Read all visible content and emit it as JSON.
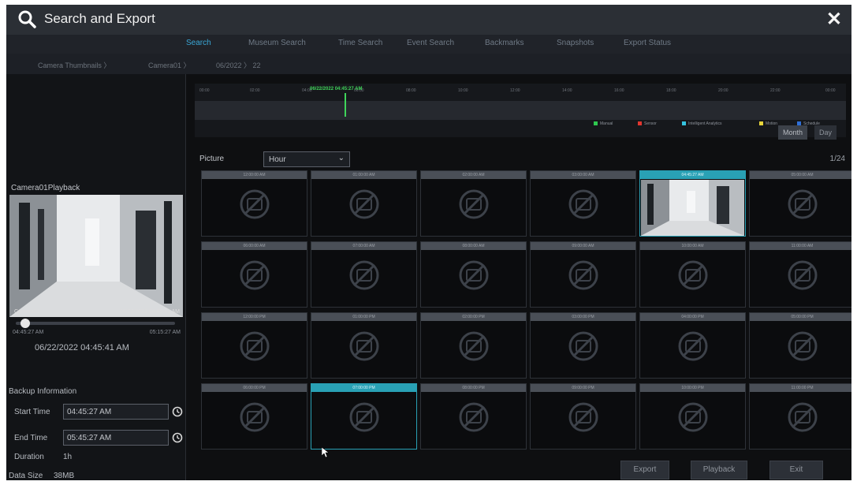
{
  "window": {
    "title": "Search and Export",
    "search_icon": "search-icon",
    "close_label": "✕"
  },
  "tabs": [
    {
      "label": "Search",
      "active": true
    },
    {
      "label": "Museum Search",
      "active": false
    },
    {
      "label": "Time Search",
      "active": false
    },
    {
      "label": "Event Search",
      "active": false
    },
    {
      "label": "Backmarks",
      "active": false
    },
    {
      "label": "Snapshots",
      "active": false
    },
    {
      "label": "Export Status",
      "active": false
    }
  ],
  "breadcrumb": [
    "Camera Thumbnails 〉",
    "Camera01 〉",
    "06/2022 〉 22"
  ],
  "playback": {
    "title": "Camera01Playback",
    "cam_label": "Camera01",
    "cam_label_right": "06/22/2022 04:45:41 AM",
    "progress": 0.05,
    "start_time": "04:45:27 AM",
    "end_time": "05:15:27 AM",
    "current": "06/22/2022 04:45:41 AM"
  },
  "backup": {
    "title": "Backup Information",
    "start_label": "Start Time",
    "start_value": "04:45:27 AM",
    "end_label": "End Time",
    "end_value": "05:45:27 AM",
    "duration_label": "Duration",
    "duration_value": "1h",
    "size_label": "Data Size",
    "size_value": "38MB"
  },
  "timeline": {
    "cursor_label": "06/22/2022 04:45:27 AM",
    "ticks": [
      "00:00",
      "02:00",
      "04:00",
      "06:00",
      "08:00",
      "10:00",
      "12:00",
      "14:00",
      "16:00",
      "18:00",
      "20:00",
      "22:00",
      "00:00"
    ],
    "legend": [
      {
        "label": "Manual",
        "color": "#2fc84f"
      },
      {
        "label": "Sensor",
        "color": "#e2362f"
      },
      {
        "label": "Intelligent Analytics",
        "color": "#35c4e0"
      },
      {
        "label": "Motion",
        "color": "#e8d53a"
      },
      {
        "label": "Schedule",
        "color": "#2f6fd8"
      }
    ],
    "month_label": "Month",
    "day_label": "Day"
  },
  "picture": {
    "label": "Picture",
    "select_value": "Hour",
    "page": "1/24"
  },
  "grid": [
    {
      "time": "12:00:00 AM"
    },
    {
      "time": "01:00:00 AM"
    },
    {
      "time": "02:00:00 AM"
    },
    {
      "time": "03:00:00 AM"
    },
    {
      "time": "04:45:27 AM",
      "selected": true,
      "photo": true
    },
    {
      "time": "05:00:00 AM"
    },
    {
      "time": "06:00:00 AM"
    },
    {
      "time": "07:00:00 AM"
    },
    {
      "time": "08:00:00 AM"
    },
    {
      "time": "09:00:00 AM"
    },
    {
      "time": "10:00:00 AM"
    },
    {
      "time": "11:00:00 AM"
    },
    {
      "time": "12:00:00 PM"
    },
    {
      "time": "01:00:00 PM"
    },
    {
      "time": "02:00:00 PM"
    },
    {
      "time": "03:00:00 PM"
    },
    {
      "time": "04:00:00 PM"
    },
    {
      "time": "05:00:00 PM"
    },
    {
      "time": "06:00:00 PM"
    },
    {
      "time": "07:00:00 PM",
      "selected": true
    },
    {
      "time": "08:00:00 PM"
    },
    {
      "time": "09:00:00 PM"
    },
    {
      "time": "10:00:00 PM"
    },
    {
      "time": "11:00:00 PM"
    }
  ],
  "buttons": {
    "export": "Export",
    "playback": "Playback",
    "exit": "Exit"
  },
  "colors": {
    "accent": "#29a1b5",
    "cursor": "#3fd45a",
    "background": "#0e0f11"
  }
}
